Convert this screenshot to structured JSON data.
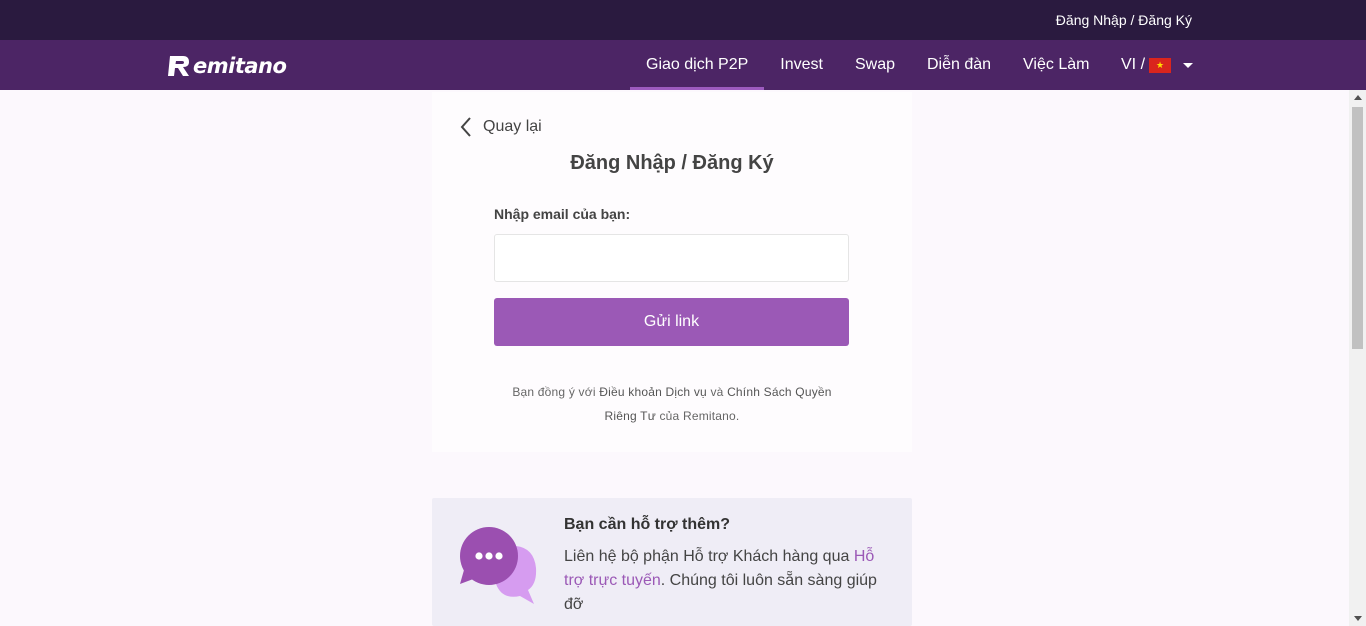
{
  "topbar": {
    "login_register": "Đăng Nhập / Đăng Ký"
  },
  "navbar": {
    "logo_text": "emitano",
    "items": [
      {
        "label": "Giao dịch P2P",
        "active": true
      },
      {
        "label": "Invest"
      },
      {
        "label": "Swap"
      },
      {
        "label": "Diễn đàn"
      },
      {
        "label": "Việc Làm"
      }
    ],
    "language": "VI /",
    "flag_star": "★"
  },
  "card": {
    "back_label": "Quay lại",
    "title": "Đăng Nhập / Đăng Ký",
    "email_label": "Nhập email của bạn:",
    "email_value": "",
    "email_placeholder": "",
    "send_button": "Gửi link",
    "terms_prefix": "Bạn đồng ý với ",
    "terms_link": "Điều khoản Dịch vụ",
    "terms_middle": " và ",
    "privacy_link": "Chính Sách Quyền Riêng Tư",
    "terms_suffix": " của Remitano."
  },
  "support": {
    "title": "Bạn cần hỗ trợ thêm?",
    "text_prefix": "Liên hệ bộ phận Hỗ trợ Khách hàng qua ",
    "link": "Hỗ trợ trực tuyến",
    "text_suffix": ". Chúng tôi luôn sẵn sàng giúp đỡ"
  },
  "colors": {
    "topbar": "#2a1a3f",
    "navbar": "#4c2565",
    "accent": "#9b59b6",
    "bubble_front": "#9b4fb0",
    "bubble_back": "#d69cf0"
  }
}
